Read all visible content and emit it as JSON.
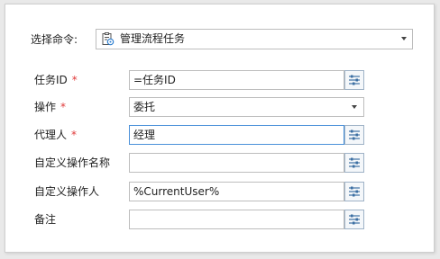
{
  "command": {
    "label": "选择命令:",
    "value": "管理流程任务",
    "icon": "task-manage-icon"
  },
  "fields": [
    {
      "label": "任务ID",
      "required": "*",
      "value": "=任务ID"
    },
    {
      "label": "操作",
      "required": "*",
      "value": "委托"
    },
    {
      "label": "代理人",
      "required": "*",
      "value": "经理"
    },
    {
      "label": "自定义操作名称",
      "value": ""
    },
    {
      "label": "自定义操作人",
      "value": "%CurrentUser%"
    },
    {
      "label": "备注",
      "value": ""
    }
  ],
  "colors": {
    "required": "#e03a3a",
    "focus_border": "#4a90d9",
    "button_icon": "#3c6fa3"
  },
  "icons": {
    "formula_button": "formula-editor-icon",
    "dropdown": "chevron-down-icon"
  }
}
